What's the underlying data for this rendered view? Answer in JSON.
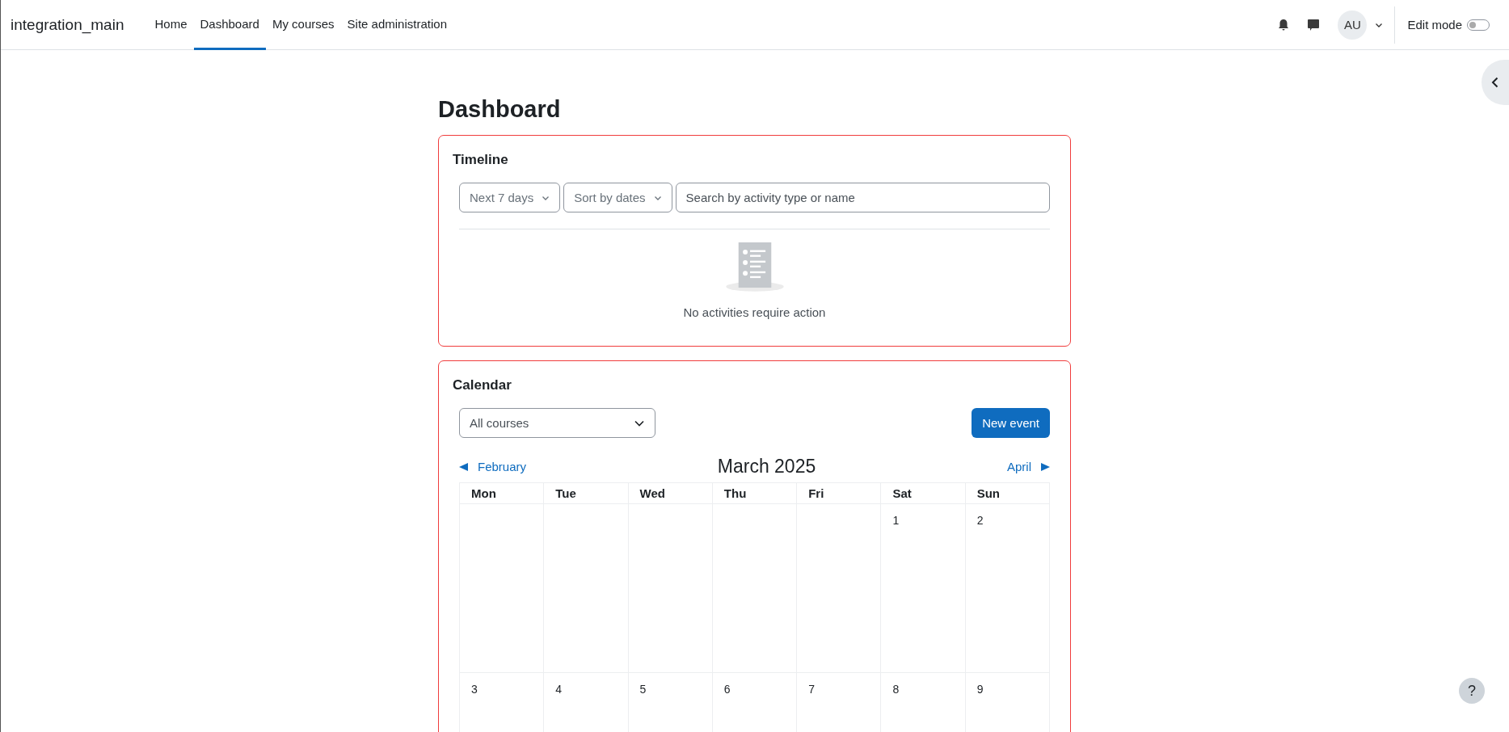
{
  "site_name": "integration_main",
  "nav": [
    {
      "label": "Home",
      "selected": false
    },
    {
      "label": "Dashboard",
      "selected": true
    },
    {
      "label": "My courses",
      "selected": false
    },
    {
      "label": "Site administration",
      "selected": false
    }
  ],
  "user": {
    "initials": "AU"
  },
  "edit_mode": {
    "label": "Edit mode",
    "on": false
  },
  "page_title": "Dashboard",
  "timeline": {
    "title": "Timeline",
    "filters": [
      "Next 7 days",
      "Sort by dates"
    ],
    "search": {
      "placeholder": "Search by activity type or name"
    },
    "empty_message": "No activities require action"
  },
  "calendar": {
    "title": "Calendar",
    "course_filter": "All courses",
    "new_event_button": "New event",
    "prev_month": "February",
    "month_title": "March 2025",
    "next_month": "April",
    "weekdays": [
      "Mon",
      "Tue",
      "Wed",
      "Thu",
      "Fri",
      "Sat",
      "Sun"
    ],
    "weeks": [
      {
        "kind": "first",
        "days": [
          "1",
          "2"
        ]
      },
      {
        "kind": "full",
        "days": [
          "3",
          "4",
          "5",
          "6",
          "7",
          "8",
          "9"
        ]
      }
    ]
  },
  "help_button": "?"
}
